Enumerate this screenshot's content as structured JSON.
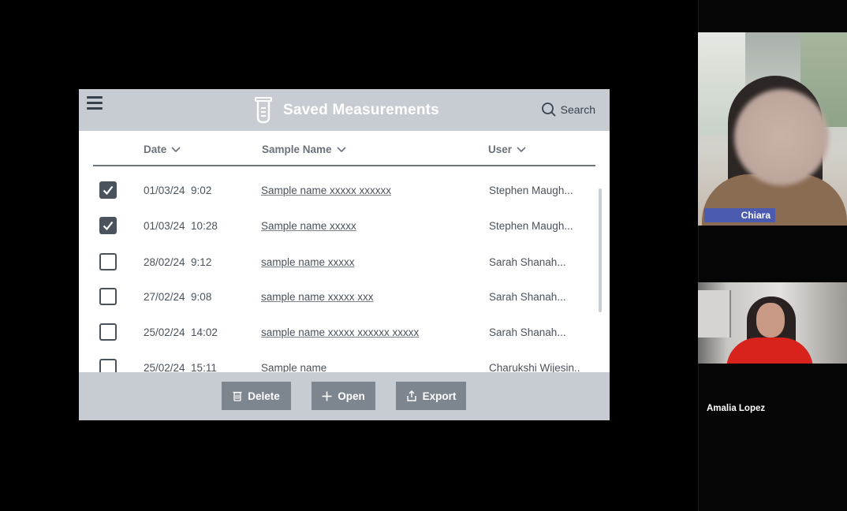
{
  "app": {
    "title": "Saved Measurements",
    "search_label": "Search",
    "columns": {
      "date": "Date",
      "sample_name": "Sample Name",
      "user": "User"
    },
    "rows": [
      {
        "checked": true,
        "date": "01/03/24  9:02",
        "sample_name": "Sample name xxxxx xxxxxx",
        "user": "Stephen Maugh..."
      },
      {
        "checked": true,
        "date": "01/03/24  10:28",
        "sample_name": "Sample name xxxxx",
        "user": "Stephen Maugh..."
      },
      {
        "checked": false,
        "date": "28/02/24  9:12",
        "sample_name": "sample name xxxxx",
        "user": "Sarah Shanah..."
      },
      {
        "checked": false,
        "date": "27/02/24  9:08",
        "sample_name": "sample name xxxxx xxx",
        "user": "Sarah Shanah..."
      },
      {
        "checked": false,
        "date": "25/02/24  14:02",
        "sample_name": "sample name xxxxx xxxxxx xxxxx",
        "user": "Sarah Shanah..."
      },
      {
        "checked": false,
        "date": "25/02/24  15:11",
        "sample_name": "Sample name",
        "user": "Charukshi Wijesin..."
      }
    ],
    "footer": {
      "delete_label": "Delete",
      "open_label": "Open",
      "export_label": "Export"
    },
    "colors": {
      "header_bg": "#c6ccd2",
      "button_bg": "#7d858e",
      "text": "#4a525c"
    }
  },
  "participants": [
    {
      "name": "Chiara"
    },
    {
      "name": "Amalia Lopez"
    }
  ]
}
